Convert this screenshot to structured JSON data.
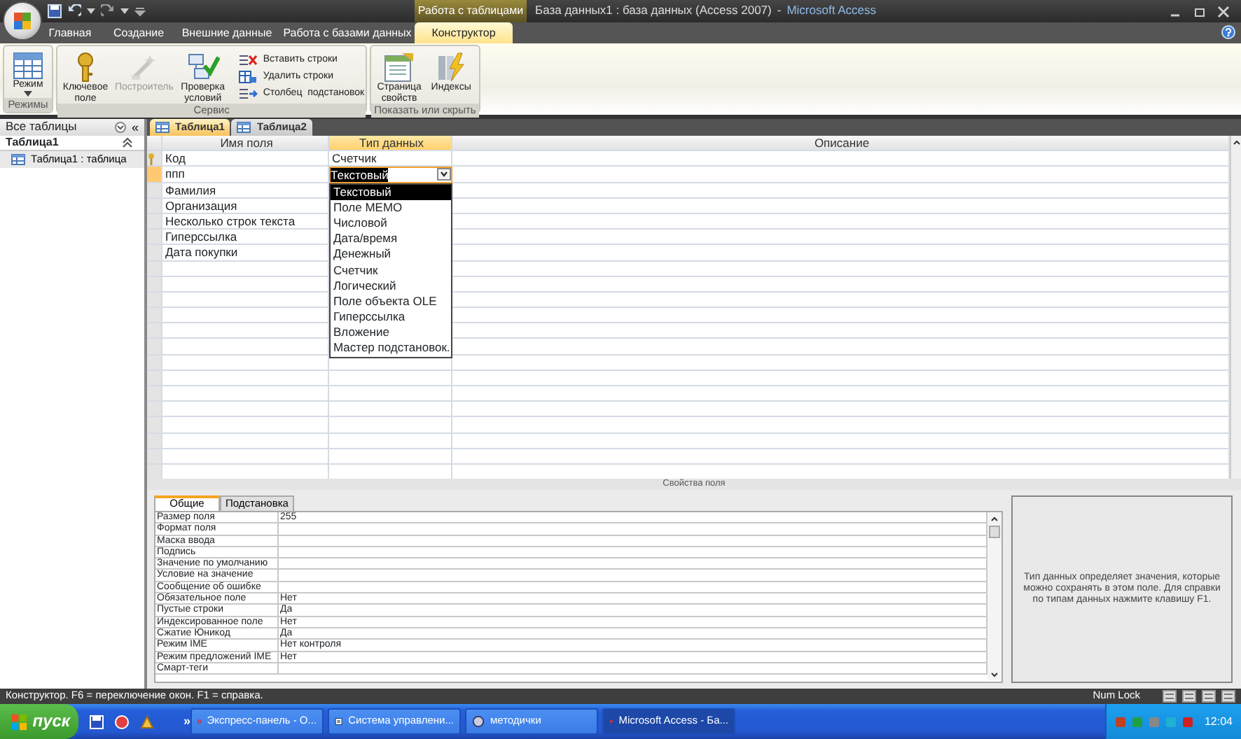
{
  "title_bar": {
    "contextual_tab": "Работа с таблицами",
    "title": "База данных1 : база данных (Access 2007)",
    "separator": "-",
    "app_name": "Microsoft Access"
  },
  "ribbon_tabs": [
    {
      "label": "Главная",
      "selected": false
    },
    {
      "label": "Создание",
      "selected": false
    },
    {
      "label": "Внешние данные",
      "selected": false
    },
    {
      "label": "Работа с базами данных",
      "selected": false
    },
    {
      "label": "Конструктор",
      "selected": true
    }
  ],
  "ribbon_groups": [
    {
      "label": "Режимы",
      "buttons": [
        {
          "label": "Режим",
          "kind": "split",
          "disabled": false
        }
      ]
    },
    {
      "label": "Сервис",
      "buttons": [
        {
          "label": "Ключевое поле",
          "kind": "large",
          "disabled": false
        },
        {
          "label": "Построитель",
          "kind": "large",
          "disabled": true
        },
        {
          "label": "Проверка условий",
          "kind": "large",
          "disabled": false
        },
        {
          "label": "Вставить строки",
          "kind": "small",
          "disabled": false
        },
        {
          "label": "Удалить строки",
          "kind": "small",
          "disabled": false
        },
        {
          "label": "Столбец  подстановок",
          "kind": "small",
          "disabled": false
        }
      ]
    },
    {
      "label": "Показать или скрыть",
      "buttons": [
        {
          "label": "Страница свойств",
          "kind": "large",
          "disabled": false
        },
        {
          "label": "Индексы",
          "kind": "large",
          "disabled": false
        }
      ]
    }
  ],
  "navigation_pane": {
    "title": "Все таблицы",
    "collapse_glyph": "«",
    "group": "Таблица1",
    "items": [
      "Таблица1 : таблица"
    ]
  },
  "document_tabs": [
    {
      "label": "Таблица1",
      "selected": true
    },
    {
      "label": "Таблица2",
      "selected": false
    }
  ],
  "design_grid": {
    "columns": [
      {
        "label": "Имя поля",
        "selected": false
      },
      {
        "label": "Тип данных",
        "selected": true
      },
      {
        "label": "Описание",
        "selected": false
      }
    ],
    "rows": [
      {
        "name": "Код",
        "type": "Счетчик",
        "primary_key": true,
        "selected": false
      },
      {
        "name": "ппп",
        "type": "Текстовый",
        "primary_key": false,
        "selected": true
      },
      {
        "name": "Фамилия",
        "primary_key": false,
        "selected": false
      },
      {
        "name": "Организация",
        "primary_key": false,
        "selected": false
      },
      {
        "name": "Несколько строк текста",
        "primary_key": false,
        "selected": false
      },
      {
        "name": "Гиперссылка",
        "primary_key": false,
        "selected": false
      },
      {
        "name": "Дата покупки",
        "primary_key": false,
        "selected": false
      }
    ]
  },
  "type_dropdown": {
    "options": [
      {
        "label": "Текстовый",
        "selected": true
      },
      {
        "label": "Поле MEMO",
        "selected": false
      },
      {
        "label": "Числовой",
        "selected": false
      },
      {
        "label": "Дата/время",
        "selected": false
      },
      {
        "label": "Денежный",
        "selected": false
      },
      {
        "label": "Счетчик",
        "selected": false
      },
      {
        "label": "Логический",
        "selected": false
      },
      {
        "label": "Поле объекта OLE",
        "selected": false
      },
      {
        "label": "Гиперссылка",
        "selected": false
      },
      {
        "label": "Вложение",
        "selected": false
      },
      {
        "label": "Мастер подстановок.",
        "selected": false
      }
    ]
  },
  "field_properties": {
    "title": "Свойства поля",
    "tabs": [
      {
        "label": "Общие",
        "selected": true
      },
      {
        "label": "Подстановка",
        "selected": false
      }
    ],
    "rows": [
      {
        "label": "Размер поля",
        "value": "255"
      },
      {
        "label": "Формат поля"
      },
      {
        "label": "Маска ввода"
      },
      {
        "label": "Подпись"
      },
      {
        "label": "Значение по умолчанию"
      },
      {
        "label": "Условие на значение"
      },
      {
        "label": "Сообщение об ошибке"
      },
      {
        "label": "Обязательное поле",
        "value": "Нет"
      },
      {
        "label": "Пустые строки",
        "value": "Да"
      },
      {
        "label": "Индексированное поле",
        "value": "Нет"
      },
      {
        "label": "Сжатие Юникод",
        "value": "Да"
      },
      {
        "label": "Режим IME",
        "value": "Нет контроля"
      },
      {
        "label": "Режим предложений IME",
        "value": "Нет"
      },
      {
        "label": "Смарт-теги"
      }
    ],
    "help": "Тип данных определяет значения, которые можно сохранять в этом поле.  Для справки по типам данных нажмите клавишу F1."
  },
  "status_bar": {
    "text": "Конструктор.  F6 = переключение окон.  F1 = справка.",
    "num_lock": "Num Lock"
  },
  "taskbar": {
    "start": "пуск",
    "more": "»",
    "tasks": [
      {
        "label": "Экспресс-панель - О...",
        "selected": false
      },
      {
        "label": "Система управлени...",
        "selected": false
      },
      {
        "label": "методички",
        "selected": false
      },
      {
        "label": "Microsoft Access - Ба...",
        "selected": true
      }
    ],
    "clock": "12:04"
  }
}
